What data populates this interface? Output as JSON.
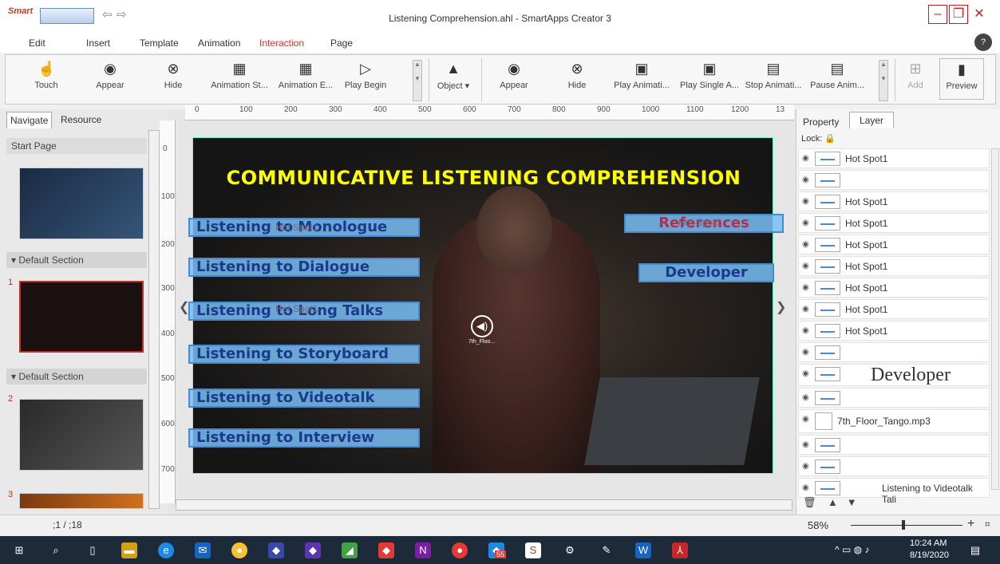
{
  "app": {
    "logo": "Smart",
    "window_title": "Listening Comprehension.ahl - SmartApps Creator 3"
  },
  "menu": [
    "Edit",
    "Insert",
    "Template",
    "Animation",
    "Interaction",
    "Page"
  ],
  "ribbon": {
    "left_tools": [
      {
        "label": "Touch",
        "icon": "hand-icon"
      },
      {
        "label": "Appear",
        "icon": "eye-icon"
      },
      {
        "label": "Hide",
        "icon": "hide-eye-icon"
      },
      {
        "label": "Animation St...",
        "icon": "film-icon"
      },
      {
        "label": "Animation E...",
        "icon": "film-end-icon"
      },
      {
        "label": "Play Begin",
        "icon": "play-icon"
      }
    ],
    "object_label": "Object",
    "right_tools": [
      {
        "label": "Appear",
        "icon": "eye-icon"
      },
      {
        "label": "Hide",
        "icon": "hide-eye-icon"
      },
      {
        "label": "Play Animati...",
        "icon": "play-anim-icon"
      },
      {
        "label": "Play Single A...",
        "icon": "play-single-icon"
      },
      {
        "label": "Stop Animati...",
        "icon": "stop-anim-icon"
      },
      {
        "label": "Pause Anim...",
        "icon": "pause-anim-icon"
      }
    ],
    "add_label": "Add",
    "preview_label": "Preview"
  },
  "left_panel": {
    "tabs": [
      "Navigate",
      "Resource"
    ],
    "start_page": "Start Page",
    "sections": [
      "Default Section",
      "Default Section"
    ],
    "page_numbers": [
      "1",
      "2",
      "3"
    ]
  },
  "rulers": {
    "h_ticks": [
      "0",
      "100",
      "200",
      "300",
      "400",
      "500",
      "600",
      "700",
      "800",
      "900",
      "1000",
      "1100",
      "1200",
      "13"
    ],
    "v_ticks": [
      "0",
      "100",
      "200",
      "300",
      "400",
      "500",
      "600",
      "700"
    ]
  },
  "slide": {
    "title": "COMMUNICATIVE LISTENING COMPREHENSION",
    "buttons": [
      "Listening to Monologue",
      "Listening to Dialogue",
      "Listening to Long Talks",
      "Listening to Storyboard",
      "Listening to Videotalk",
      "Listening to Interview"
    ],
    "right_buttons": [
      "References",
      "Developer"
    ],
    "hotspot_label": "Hot Spot1",
    "audio_caption": "7th_Floo..."
  },
  "right_panel": {
    "tabs": [
      "Property",
      "Layer"
    ],
    "lock_label": "Lock:",
    "layers": [
      "Hot Spot1",
      "",
      "Hot Spot1",
      "Hot Spot1",
      "Hot Spot1",
      "Hot Spot1",
      "Hot Spot1",
      "Hot Spot1",
      "Hot Spot1",
      "",
      "Developer",
      "",
      "7th_Floor_Tango.mp3",
      "",
      "",
      "Listening to Videotalk Tali"
    ]
  },
  "status": {
    "page_indicator": ";1  /  ;18",
    "zoom": "58%"
  },
  "taskbar": {
    "time": "10:24 AM",
    "date": "8/19/2020",
    "badge": "55"
  }
}
